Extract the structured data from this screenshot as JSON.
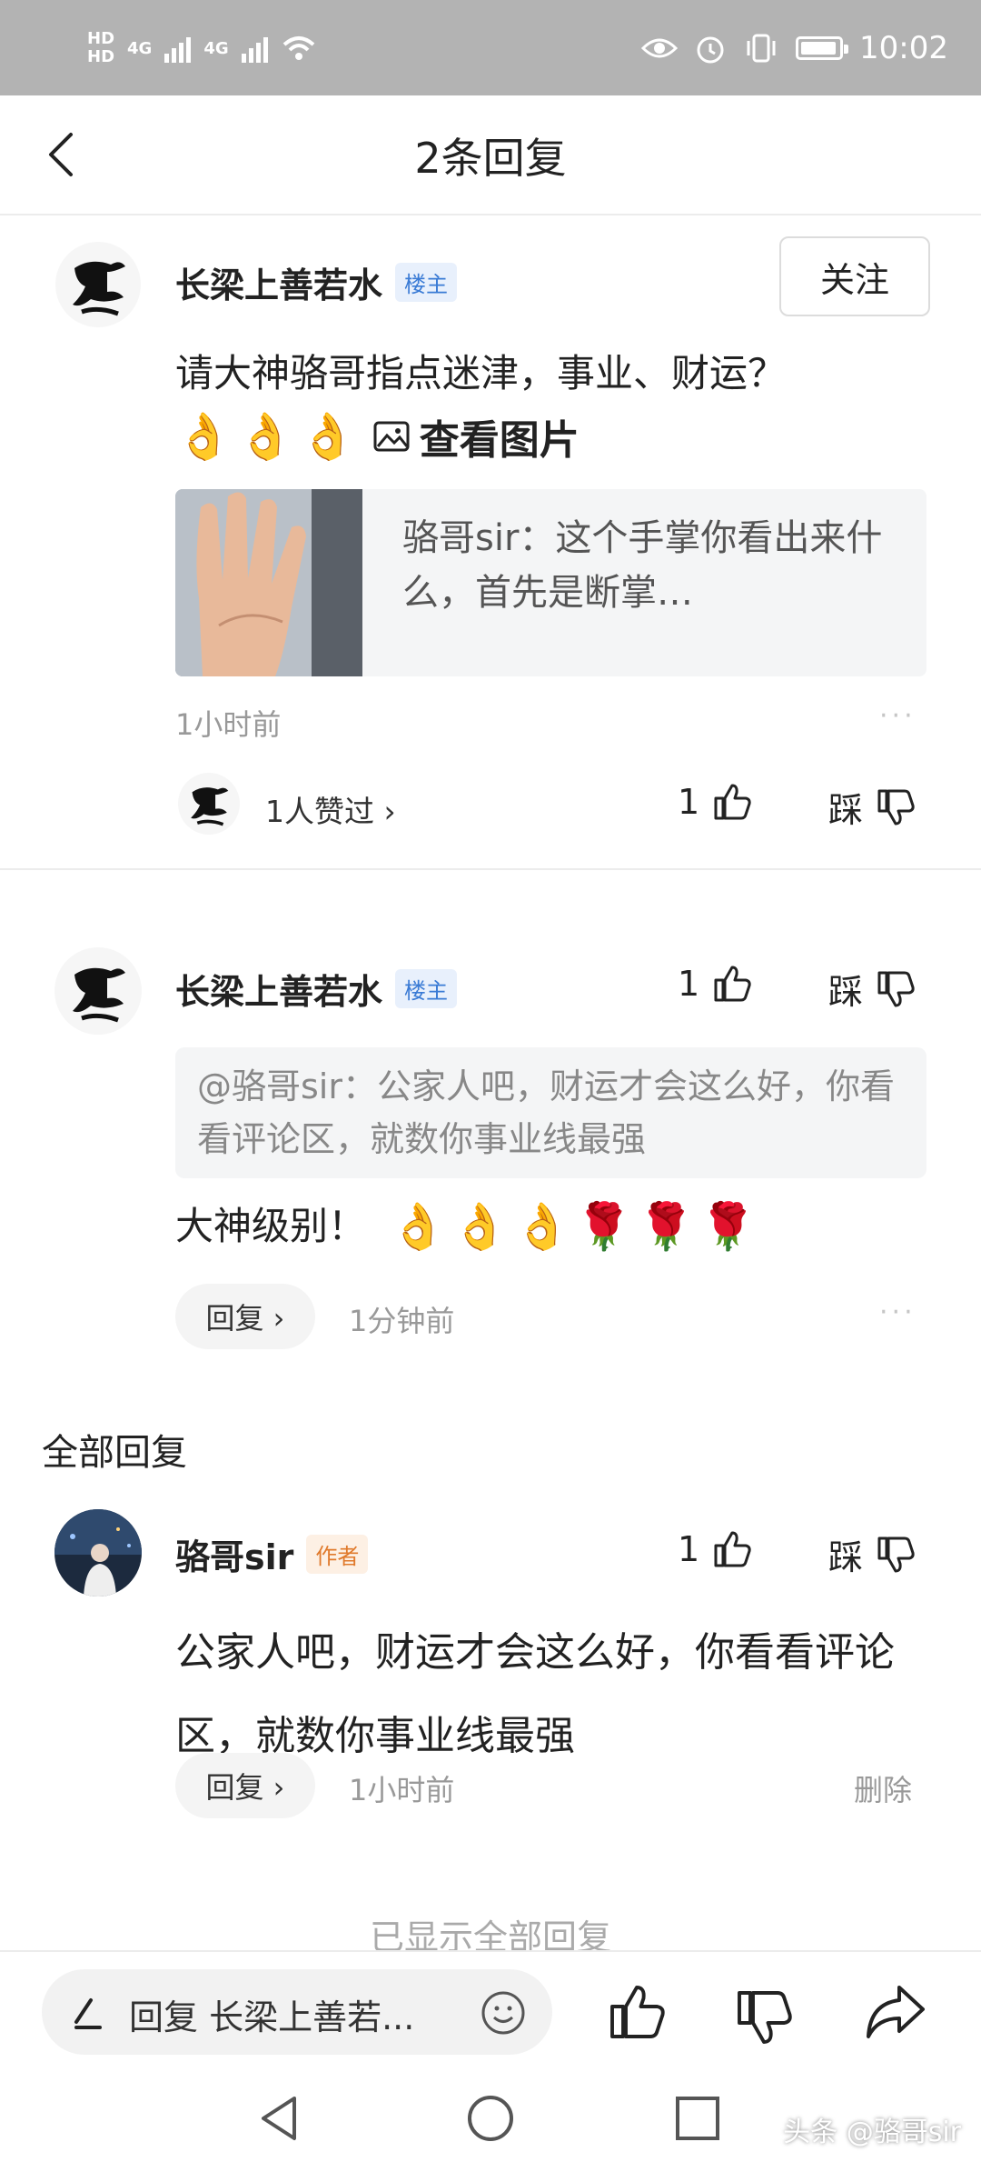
{
  "status_bar": {
    "time": "10:02",
    "network1": "4G",
    "network2": "4G",
    "hd1": "HD",
    "hd2": "HD"
  },
  "header": {
    "title": "2条回复"
  },
  "main_comment": {
    "user": "长梁上善若水",
    "badge": "楼主",
    "follow_label": "关注",
    "text": "请大神骆哥指点迷津，事业、财运？",
    "emojis": [
      "👌",
      "👌",
      "👌"
    ],
    "view_image_label": "查看图片",
    "card_text": "骆哥sir：这个手掌你看出来什么，首先是断掌…",
    "time": "1小时前",
    "likers_label": "1人赞过 ›",
    "like_count": "1",
    "dislike_label": "踩"
  },
  "reply_comment": {
    "user": "长梁上善若水",
    "badge": "楼主",
    "like_count": "1",
    "dislike_label": "踩",
    "quote": "@骆哥sir：公家人吧，财运才会这么好，你看看评论区，就数你事业线最强",
    "text": "大神级别！",
    "emojis": [
      "👌",
      "👌",
      "👌",
      "🌹",
      "🌹",
      "🌹"
    ],
    "reply_label": "回复 ›",
    "time": "1分钟前"
  },
  "all_replies": {
    "heading": "全部回复",
    "items": [
      {
        "user": "骆哥sir",
        "badge": "作者",
        "like_count": "1",
        "dislike_label": "踩",
        "text": "公家人吧，财运才会这么好，你看看评论区，就数你事业线最强",
        "reply_label": "回复 ›",
        "time": "1小时前",
        "delete_label": "删除"
      }
    ],
    "end_label": "已显示全部回复"
  },
  "bottom_bar": {
    "input_placeholder": "回复 长梁上善若..."
  },
  "watermark": "头条 @骆哥sir",
  "colors": {
    "accent_blue": "#3a7bd5",
    "author_orange": "#e07a2c",
    "muted": "#999999"
  }
}
